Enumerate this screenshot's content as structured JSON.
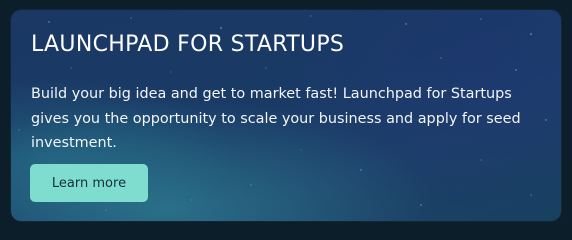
{
  "card": {
    "title": "LAUNCHPAD FOR STARTUPS",
    "description": "Build your big idea and get to market fast! Launchpad for Startups gives you the opportunity to scale your business and apply for seed investment.",
    "button_label": "Learn more",
    "colors": {
      "background": "#1a3863",
      "accent_glow": "#3496a0",
      "button": "#7fddd0",
      "button_text": "#14303a",
      "text": "#ffffff"
    }
  }
}
